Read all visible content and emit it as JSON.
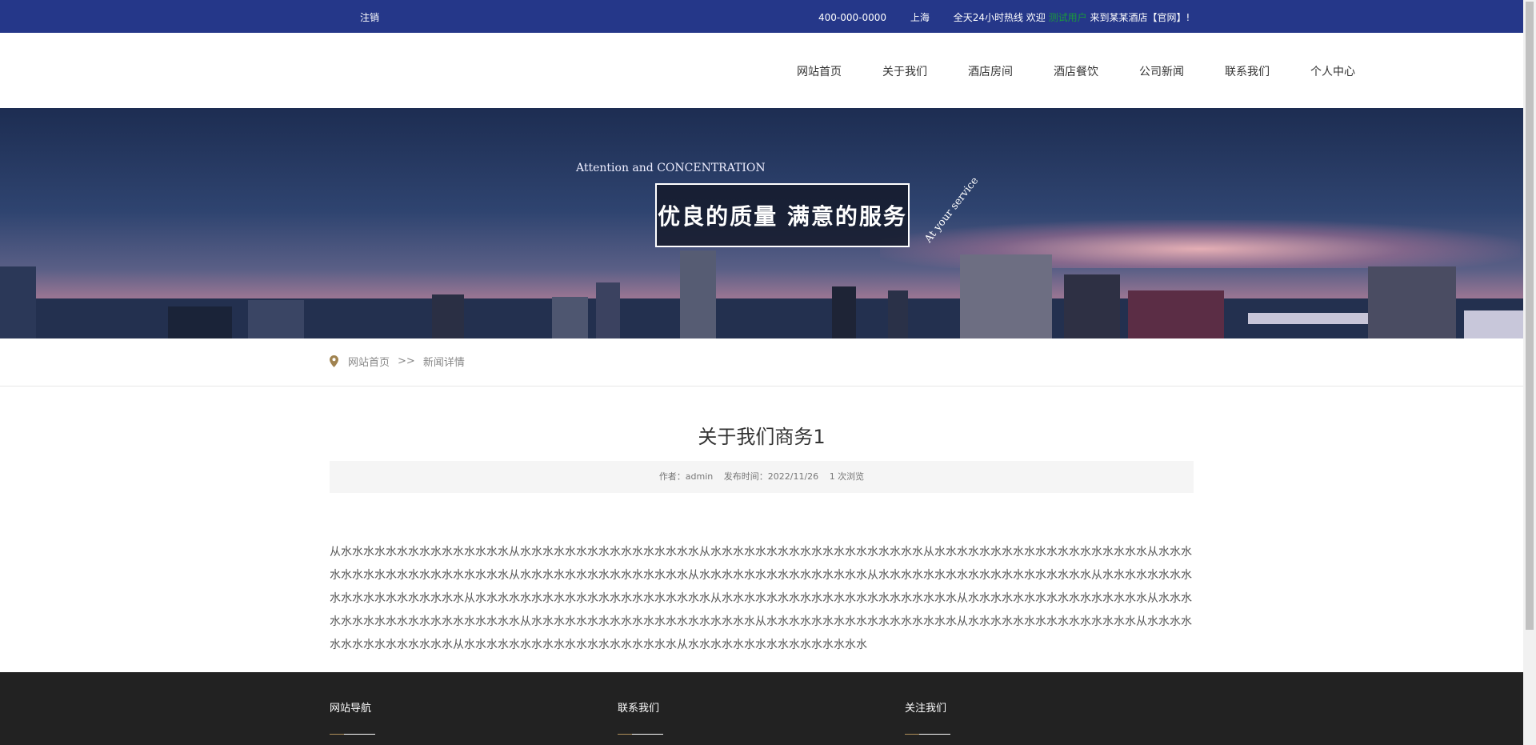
{
  "topbar": {
    "logout_label": "注销",
    "phone": "400-000-0000",
    "city": "上海",
    "hours": "全天24小时热线",
    "welcome_prefix": "欢迎",
    "username": "测试用户",
    "welcome_suffix": "来到某某酒店【官网】!"
  },
  "nav": {
    "items": [
      {
        "label": "网站首页"
      },
      {
        "label": "关于我们"
      },
      {
        "label": "酒店房间"
      },
      {
        "label": "酒店餐饮"
      },
      {
        "label": "公司新闻"
      },
      {
        "label": "联系我们"
      },
      {
        "label": "个人中心"
      }
    ]
  },
  "banner": {
    "tagline": "Attention and CONCENTRATION",
    "headline": "优良的质量 满意的服务",
    "slant_text": "At your service"
  },
  "breadcrumb": {
    "home": "网站首页",
    "separator": ">>",
    "current": "新闻详情"
  },
  "article": {
    "title": "关于我们商务1",
    "author": "作者：admin",
    "published": "发布时间：2022/11/26",
    "views": "1 次浏览",
    "body": "从水水水水水水水水水水水水水水水从水水水水水水水水水水水水水水水水从水水水水水水水水水水水水水水水水水水水从水水水水水水水水水水水水水水水水水水水从水水水水水水水水水水水水水水水水水水水从水水水水水水水水水水水水水水水从水水水水水水水水水水水水水水水从水水水水水水水水水水水水水水水水水水水从水水水水水水水水水水水水水水水水水水水水从水水水水水水水水水水水水水水水水水水水水水从水水水水水水水水水水水水水水水水水水水水水从水水水水水水水水水水水水水水水水从水水水水水水水水水水水水水水水水水水水水从水水水水水水水水水水水水水水水水水水水水从水水水水水水水水水水水水水水水水水从水水水水水水水水水水水水水水水从水水水水水水水水水水水水水水水从水水水水水水水水水水水水水水水水水水水从水水水水水水水水水水水水水水水水"
  },
  "footer": {
    "col1": "网站导航",
    "col2": "联系我们",
    "col3": "关注我们"
  },
  "colors": {
    "topbar_bg": "#253789",
    "username": "#1a9a3a",
    "footer_bg": "#222222",
    "accent_line": "#b0905a"
  }
}
